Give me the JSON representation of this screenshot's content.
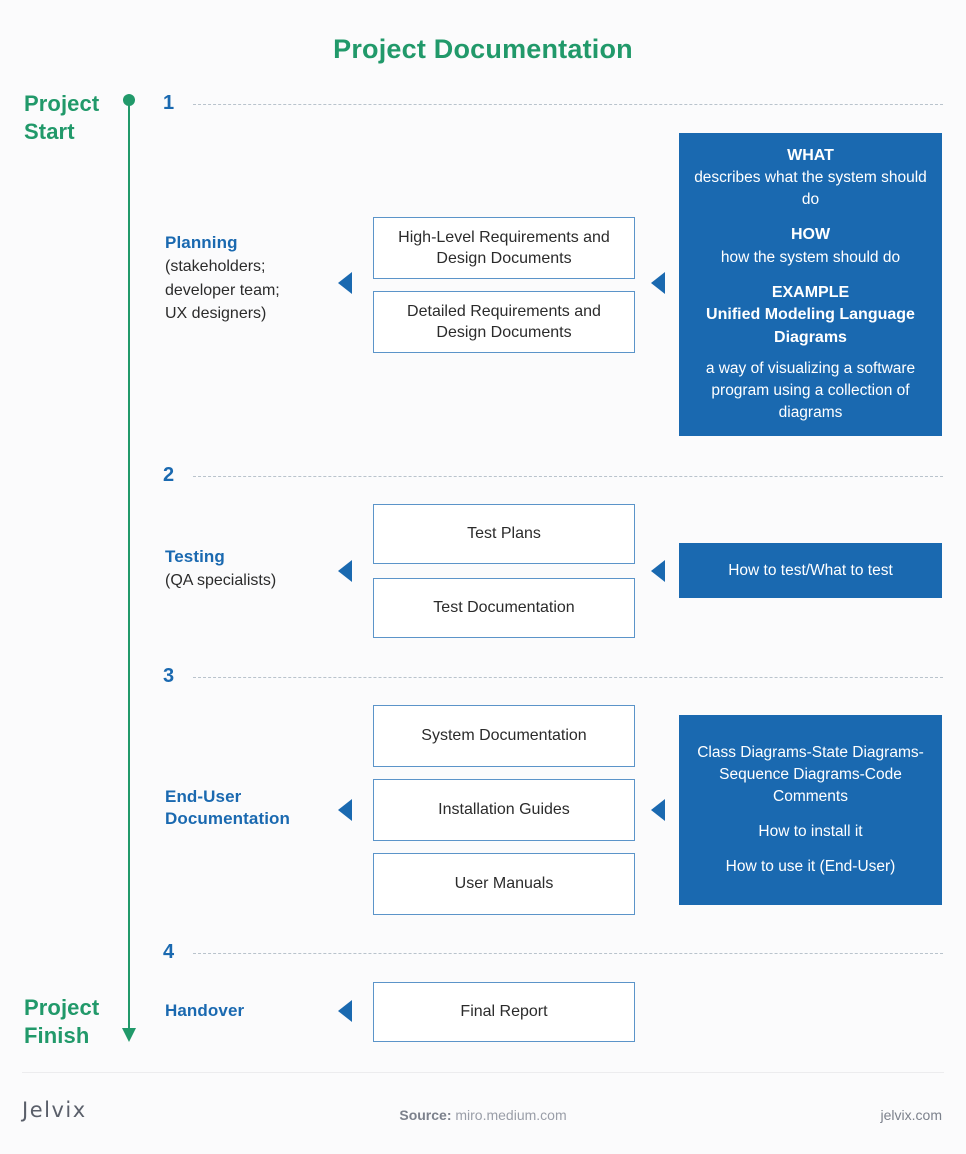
{
  "title": {
    "light": "Project ",
    "bold": "Documentation"
  },
  "timeline": {
    "start_label": "Project\nStart",
    "start_line1": "Project",
    "start_line2": "Start",
    "finish_line1": "Project",
    "finish_line2": "Finish",
    "color": "#21996a"
  },
  "accent_blue": "#1a69b0",
  "steps": [
    {
      "number": "1",
      "stage_title": "Planning",
      "stage_sub": "(stakeholders;\ndeveloper team;\nUX designers)",
      "stage_sub_lines": [
        "(stakeholders;",
        "developer team;",
        "UX designers)"
      ],
      "boxes": [
        "High-Level Requirements and Design Documents",
        "Detailed Requirements and Design Documents"
      ],
      "panel": [
        {
          "style": "head",
          "text": "WHAT"
        },
        {
          "style": "text",
          "text": "describes what the system should do"
        },
        {
          "style": "head",
          "text": "HOW"
        },
        {
          "style": "text",
          "text": "how the system should do"
        },
        {
          "style": "head",
          "text": "EXAMPLE"
        },
        {
          "style": "head",
          "text": "Unified Modeling Language Diagrams"
        },
        {
          "style": "text",
          "text": "a way of visualizing a software program using a collection of diagrams"
        }
      ]
    },
    {
      "number": "2",
      "stage_title": "Testing",
      "stage_sub_lines": [
        "(QA specialists)"
      ],
      "boxes": [
        "Test Plans",
        "Test Documentation"
      ],
      "panel": [
        {
          "style": "text",
          "text": "How to test/What to test"
        }
      ]
    },
    {
      "number": "3",
      "stage_title": "End-User Documentation",
      "stage_title_lines": [
        "End-User",
        "Documentation"
      ],
      "stage_sub_lines": [],
      "boxes": [
        "System Documentation",
        "Installation Guides",
        "User Manuals"
      ],
      "panel": [
        {
          "style": "text",
          "text": "Class Diagrams-State Diagrams-Sequence Diagrams-Code Comments"
        },
        {
          "style": "text",
          "text": "How to install it"
        },
        {
          "style": "text",
          "text": "How to use it (End-User)"
        }
      ]
    },
    {
      "number": "4",
      "stage_title": "Handover",
      "stage_sub_lines": [],
      "boxes": [
        "Final Report"
      ],
      "panel": []
    }
  ],
  "footer": {
    "logo": "Jelvix",
    "source_label": "Source:",
    "source_value": "miro.medium.com",
    "site": "jelvix.com"
  }
}
